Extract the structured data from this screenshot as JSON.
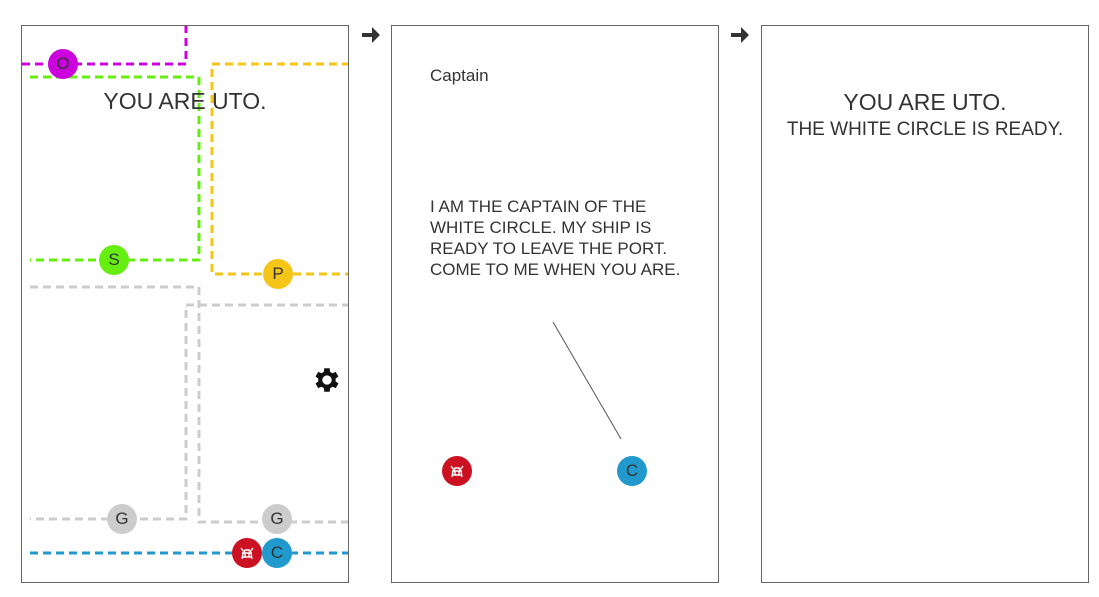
{
  "panel1": {
    "heading": "YOU ARE UTO.",
    "nodes": {
      "o": "O",
      "s": "S",
      "p": "P",
      "g1": "G",
      "g2": "G",
      "c": "C"
    }
  },
  "panel2": {
    "speaker": "Captain",
    "speech": "I AM THE CAPTAIN OF THE WHITE CIRCLE. MY SHIP IS READY TO LEAVE THE PORT. COME TO ME WHEN YOU ARE.",
    "node_c": "C"
  },
  "panel3": {
    "line1": "YOU ARE UTO.",
    "line2": "THE WHITE CIRCLE IS READY."
  },
  "colors": {
    "purple": "#cc00dd",
    "green": "#66ee11",
    "yellow": "#f5c518",
    "gray": "#cccccc",
    "blue": "#2299cc",
    "red": "#cc1122"
  },
  "icons": [
    "arrow-right-icon",
    "gear-icon",
    "ship-icon"
  ]
}
